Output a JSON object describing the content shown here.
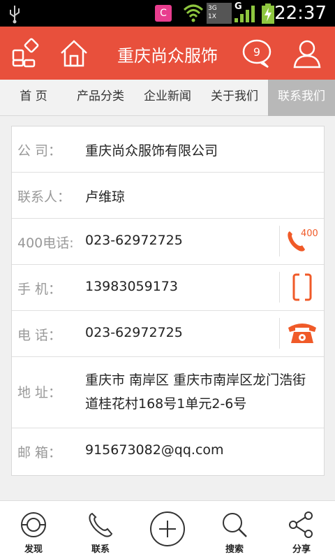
{
  "statusbar": {
    "time": "22:37",
    "app_letter": "C",
    "net_label_1": "3G",
    "net_label_2": "1X",
    "net_g": "G"
  },
  "header": {
    "title": "重庆尚众服饰",
    "message_count": "9"
  },
  "nav": {
    "tabs": [
      {
        "label": "首 页"
      },
      {
        "label": "产品分类"
      },
      {
        "label": "企业新闻"
      },
      {
        "label": "关于我们"
      },
      {
        "label": "联系我们"
      }
    ]
  },
  "contact": {
    "rows": [
      {
        "label": "公    司：",
        "value": "重庆尚众服饰有限公司"
      },
      {
        "label": "联系人：",
        "value": "卢维琼"
      },
      {
        "label": "400电话:",
        "value": "023-62972725"
      },
      {
        "label": "手    机：",
        "value": "13983059173"
      },
      {
        "label": "电    话：",
        "value": "023-62972725"
      },
      {
        "label": "地    址：",
        "value": "重庆市 南岸区 重庆市南岸区龙门浩街道桂花村168号1单元2-6号"
      },
      {
        "label": "邮    箱：",
        "value": "915673082@qq.com"
      }
    ],
    "badge_400": "400"
  },
  "bottombar": {
    "items": [
      {
        "label": "发现"
      },
      {
        "label": "联系"
      },
      {
        "label": ""
      },
      {
        "label": "搜索"
      },
      {
        "label": "分享"
      }
    ]
  },
  "colors": {
    "brand": "#e8503c",
    "accent": "#f05a28"
  }
}
